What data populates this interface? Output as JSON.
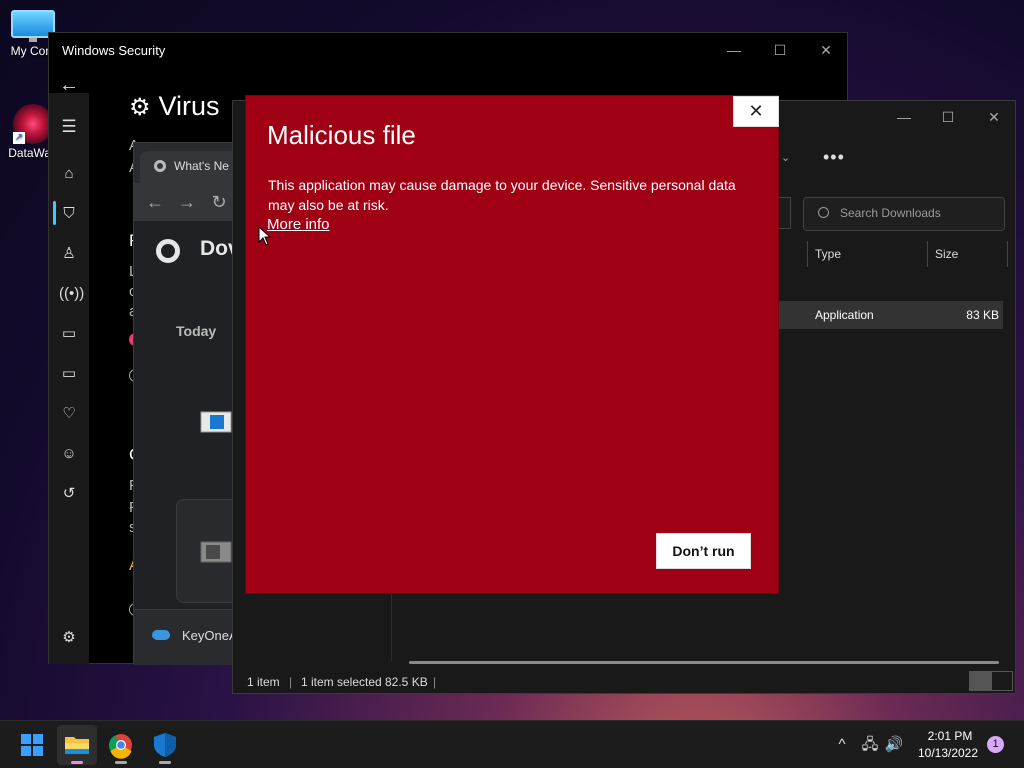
{
  "desktop": {
    "icons": [
      {
        "label": "My Com"
      },
      {
        "label": "DataWag"
      }
    ]
  },
  "windows_security": {
    "title": "Windows Security",
    "heading": "Virus",
    "fragments": [
      "A",
      "A",
      "R",
      "L",
      "c",
      "a",
      "C",
      "F",
      "F",
      "s",
      "A"
    ]
  },
  "chrome": {
    "tab_title": "What's Ne",
    "page_title": "Dov",
    "section_today": "Today",
    "bottom_item": "KeyOneA"
  },
  "file_explorer": {
    "search_placeholder": "Search Downloads",
    "columns": {
      "type": "Type",
      "size": "Size"
    },
    "row": {
      "type": "Application",
      "size": "83 KB"
    },
    "status": {
      "items": "1 item",
      "selected": "1 item selected",
      "selected_size": "82.5 KB"
    }
  },
  "dialog": {
    "title": "Malicious file",
    "message": "This application may cause damage to your device. Sensitive personal data may also be at risk.",
    "more_info": "More info",
    "dont_run": "Don’t run",
    "close_glyph": "✕"
  },
  "taskbar": {
    "time": "2:01 PM",
    "date": "10/13/2022",
    "notification_count": "1"
  },
  "colors": {
    "dialog_red": "#a00014",
    "accent_blue": "#0078d4"
  }
}
